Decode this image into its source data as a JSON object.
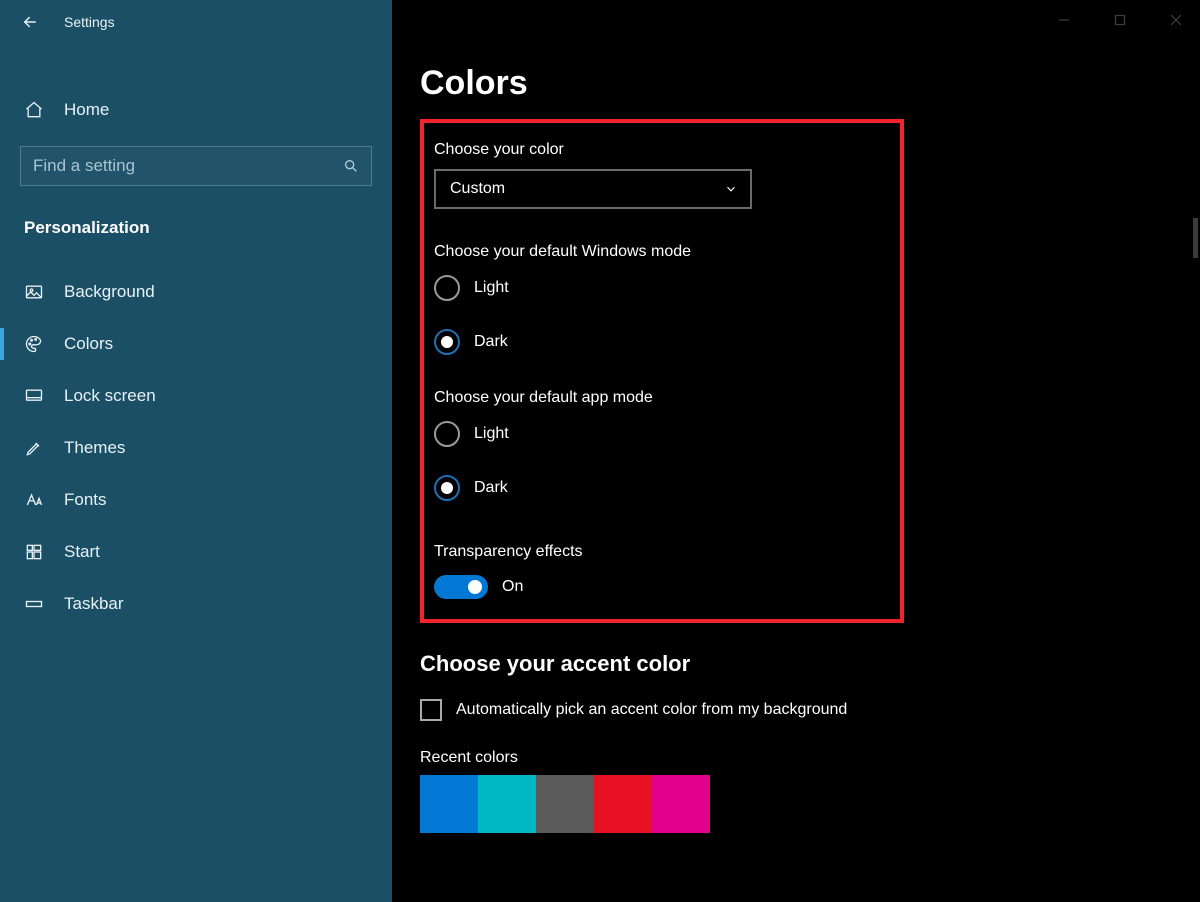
{
  "titlebar": {
    "app_name": "Settings"
  },
  "sidebar": {
    "home_label": "Home",
    "search_placeholder": "Find a setting",
    "section_title": "Personalization",
    "items": [
      {
        "label": "Background",
        "icon": "picture-icon",
        "selected": false
      },
      {
        "label": "Colors",
        "icon": "palette-icon",
        "selected": true
      },
      {
        "label": "Lock screen",
        "icon": "monitor-icon",
        "selected": false
      },
      {
        "label": "Themes",
        "icon": "brush-icon",
        "selected": false
      },
      {
        "label": "Fonts",
        "icon": "font-icon",
        "selected": false
      },
      {
        "label": "Start",
        "icon": "start-icon",
        "selected": false
      },
      {
        "label": "Taskbar",
        "icon": "taskbar-icon",
        "selected": false
      }
    ]
  },
  "page": {
    "title": "Colors",
    "choose_color_label": "Choose your color",
    "color_mode_value": "Custom",
    "windows_mode_label": "Choose your default Windows mode",
    "windows_mode_options": [
      "Light",
      "Dark"
    ],
    "windows_mode_selected": "Dark",
    "app_mode_label": "Choose your default app mode",
    "app_mode_options": [
      "Light",
      "Dark"
    ],
    "app_mode_selected": "Dark",
    "transparency_label": "Transparency effects",
    "transparency_state": "On",
    "accent_title": "Choose your accent color",
    "auto_accent_label": "Automatically pick an accent color from my background",
    "recent_colors_label": "Recent colors",
    "recent_colors": [
      "#0078d4",
      "#00b7c3",
      "#5a5a5a",
      "#e81123",
      "#e3008c"
    ]
  }
}
